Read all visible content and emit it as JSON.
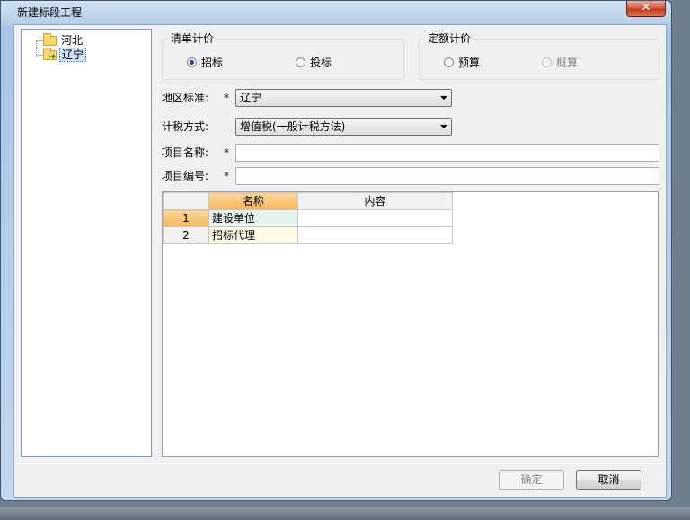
{
  "window": {
    "title": "新建标段工程",
    "close_glyph": "✕"
  },
  "tree": {
    "items": [
      {
        "label": "河北",
        "icon": "folder-icon",
        "selected": false
      },
      {
        "label": "辽宁",
        "icon": "folder-open-arrow-icon",
        "selected": true
      }
    ]
  },
  "qingdan": {
    "title": "清单计价",
    "options": [
      {
        "label": "招标",
        "checked": true
      },
      {
        "label": "投标",
        "checked": false
      }
    ]
  },
  "dinge": {
    "title": "定额计价",
    "options": [
      {
        "label": "预算",
        "checked": false
      },
      {
        "label": "概算",
        "checked": false,
        "disabled": true
      }
    ]
  },
  "form": {
    "region_label": "地区标准:",
    "region_value": "辽宁",
    "tax_label": "计税方式:",
    "tax_value": "增值税(一般计税方法)",
    "name_label": "项目名称:",
    "name_value": "",
    "code_label": "项目编号:",
    "code_value": "",
    "required_mark": "*"
  },
  "grid": {
    "columns": [
      "名称",
      "内容"
    ],
    "rows": [
      {
        "num": "1",
        "name": "建设单位",
        "content": ""
      },
      {
        "num": "2",
        "name": "招标代理",
        "content": ""
      }
    ]
  },
  "buttons": {
    "ok": "确定",
    "cancel": "取消"
  }
}
